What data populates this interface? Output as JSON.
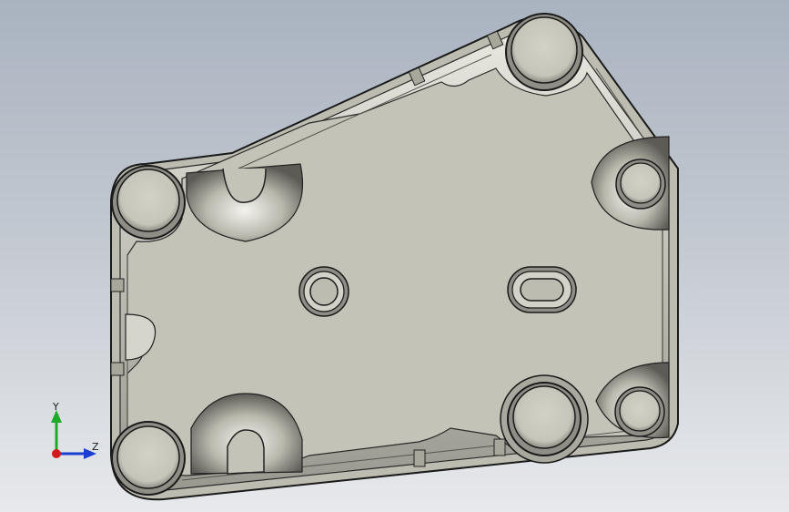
{
  "viewport": {
    "background_top": "#a9b3c0",
    "background_bottom": "#e7e9ec"
  },
  "part": {
    "face_color": "#c4c3b8",
    "edge_color": "#1a1a1a"
  },
  "triad": {
    "y_label": "Y",
    "z_label": "Z",
    "x_color": "#d11a1a",
    "y_color": "#1faa2a",
    "z_color": "#1a3fd1"
  }
}
